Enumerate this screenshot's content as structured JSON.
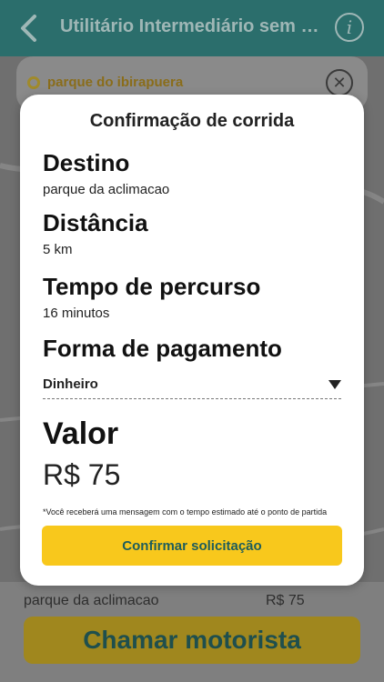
{
  "header": {
    "title": "Utilitário Intermediário sem ca...",
    "back_icon": "chevron-left-icon",
    "info_icon": "info-icon",
    "info_glyph": "i"
  },
  "origin": {
    "label": "parque do ibirapuera",
    "close_glyph": "✕"
  },
  "modal": {
    "title": "Confirmação de corrida",
    "destino_label": "Destino",
    "destino_value": "parque da aclimacao",
    "distancia_label": "Distância",
    "distancia_value": "5 km",
    "tempo_label": "Tempo de percurso",
    "tempo_value": "16 minutos",
    "pagamento_label": "Forma de pagamento",
    "pagamento_value": "Dinheiro",
    "valor_label": "Valor",
    "valor_amount": "R$ 75",
    "note": "*Você receberá uma mensagem com o tempo estimado até o ponto de partida",
    "confirm_label": "Confirmar solicitação"
  },
  "bottom": {
    "destination": "parque da aclimacao",
    "price": "R$ 75",
    "call_label": "Chamar motorista"
  },
  "colors": {
    "brand_teal": "#2b6e6c",
    "accent_yellow": "#f8c81c",
    "button_text_teal": "#1f5d5b"
  }
}
